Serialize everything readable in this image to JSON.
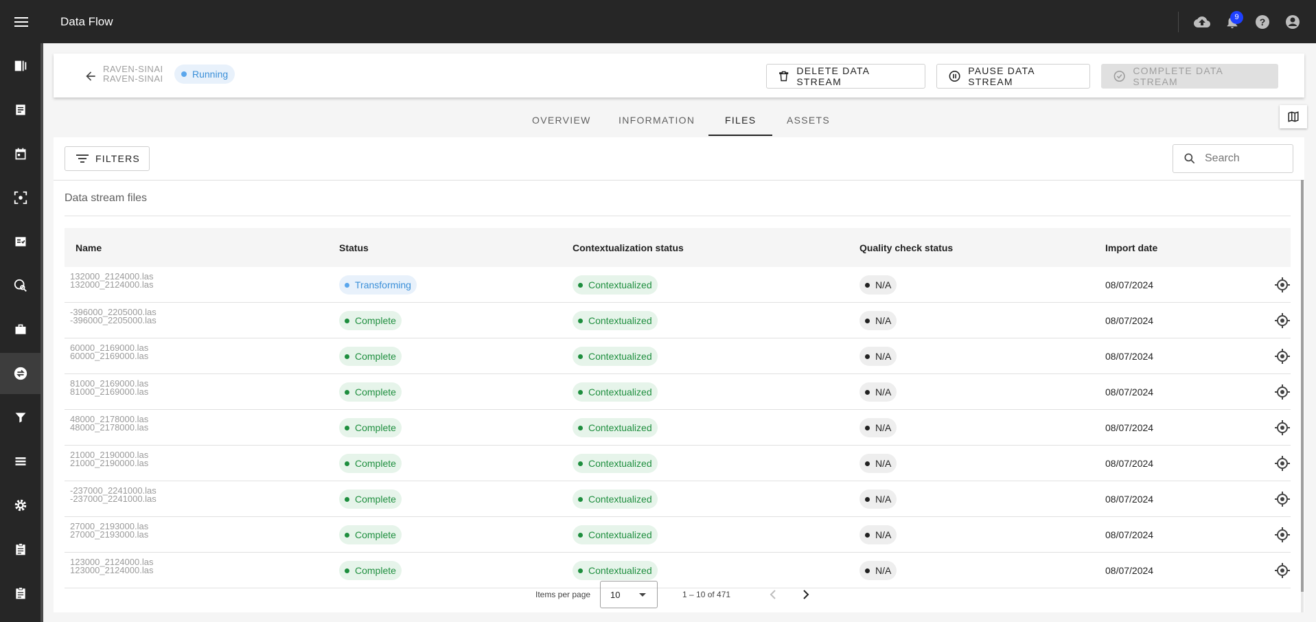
{
  "app": {
    "title": "Data Flow",
    "notifications_count": "9"
  },
  "header": {
    "stream_name": "RAVEN-SINAI",
    "status": "Running",
    "delete_label": "DELETE DATA STREAM",
    "pause_label": "PAUSE DATA STREAM",
    "complete_label": "COMPLETE DATA STREAM"
  },
  "tabs": [
    {
      "label": "OVERVIEW"
    },
    {
      "label": "INFORMATION"
    },
    {
      "label": "FILES",
      "active": true
    },
    {
      "label": "ASSETS"
    }
  ],
  "toolbar": {
    "filters_label": "FILTERS",
    "search_placeholder": "Search"
  },
  "section_title": "Data stream files",
  "table": {
    "columns": [
      "Name",
      "Status",
      "Contextualization status",
      "Quality check status",
      "Import date"
    ],
    "rows": [
      {
        "name": "132000_2124000.las",
        "status": "Transforming",
        "ctx": "Contextualized",
        "qc": "N/A",
        "date": "08/07/2024"
      },
      {
        "name": "-396000_2205000.las",
        "status": "Complete",
        "ctx": "Contextualized",
        "qc": "N/A",
        "date": "08/07/2024"
      },
      {
        "name": "60000_2169000.las",
        "status": "Complete",
        "ctx": "Contextualized",
        "qc": "N/A",
        "date": "08/07/2024"
      },
      {
        "name": "81000_2169000.las",
        "status": "Complete",
        "ctx": "Contextualized",
        "qc": "N/A",
        "date": "08/07/2024"
      },
      {
        "name": "48000_2178000.las",
        "status": "Complete",
        "ctx": "Contextualized",
        "qc": "N/A",
        "date": "08/07/2024"
      },
      {
        "name": "21000_2190000.las",
        "status": "Complete",
        "ctx": "Contextualized",
        "qc": "N/A",
        "date": "08/07/2024"
      },
      {
        "name": "-237000_2241000.las",
        "status": "Complete",
        "ctx": "Contextualized",
        "qc": "N/A",
        "date": "08/07/2024"
      },
      {
        "name": "27000_2193000.las",
        "status": "Complete",
        "ctx": "Contextualized",
        "qc": "N/A",
        "date": "08/07/2024"
      },
      {
        "name": "123000_2124000.las",
        "status": "Complete",
        "ctx": "Contextualized",
        "qc": "N/A",
        "date": "08/07/2024"
      }
    ]
  },
  "pagination": {
    "items_per_page_label": "Items per page",
    "items_per_page": "10",
    "range": "1 – 10 of 471"
  },
  "colors": {
    "appbar": "#262626",
    "running": "#3a8fd8",
    "complete": "#1e8e3e",
    "badge": "#1e40ff"
  }
}
